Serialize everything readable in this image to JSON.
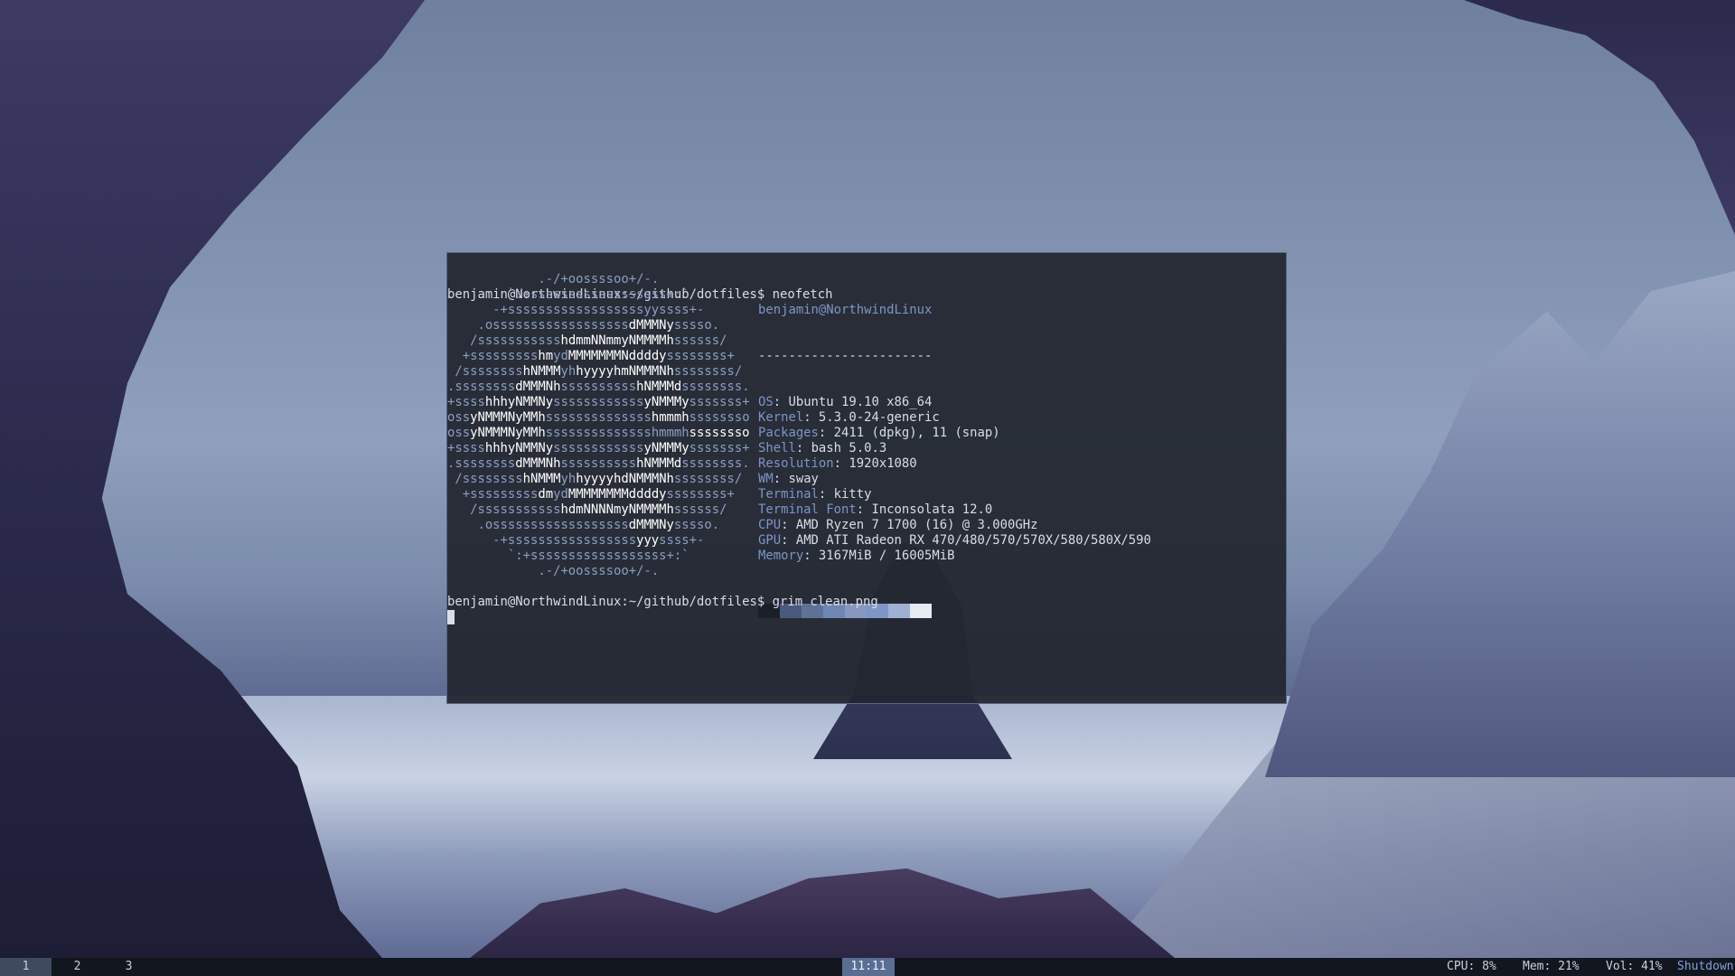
{
  "terminal": {
    "prompt1": "benjamin@NorthwindLinux:~/github/dotfiles$ neofetch",
    "logo": [
      [
        "            .-/+oossssoo+/-.",
        ""
      ],
      [
        "        `:+ssssssssssssssssss+:`",
        ""
      ],
      [
        "      -+ssssssssssssssssssyyssss+-",
        ""
      ],
      [
        "    .ossssssssssssssssss",
        "dMMMNy",
        "sssso."
      ],
      [
        "   /sssssssssss",
        "hdmmNNmmyNMMMMh",
        "ssssss/"
      ],
      [
        "  +sssssssss",
        "hm",
        "yd",
        "MMMMMMMNddddy",
        "ssssssss+"
      ],
      [
        " /ssssssss",
        "hNMMM",
        "yh",
        "hyyyyhmNMMMNh",
        "ssssssss/"
      ],
      [
        ".ssssssss",
        "dMMMNh",
        "ssssssssss",
        "hNMMMd",
        "ssssssss."
      ],
      [
        "+ssss",
        "hhhyNMMNy",
        "ssssssssssss",
        "yNMMMy",
        "sssssss+"
      ],
      [
        "oss",
        "yNMMMNyMMh",
        "ssssssssssssss",
        "hmmmh",
        "ssssssso"
      ],
      [
        "oss",
        "yNMMMNyMMh",
        "sssssssssssssshmmmh",
        "ssssssso",
        ""
      ],
      [
        "+ssss",
        "hhhyNMMNy",
        "ssssssssssss",
        "yNMMMy",
        "sssssss+"
      ],
      [
        ".ssssssss",
        "dMMMNh",
        "ssssssssss",
        "hNMMMd",
        "ssssssss."
      ],
      [
        " /ssssssss",
        "hNMMM",
        "yh",
        "hyyyyhdNMMMNh",
        "ssssssss/"
      ],
      [
        "  +sssssssss",
        "dm",
        "yd",
        "MMMMMMMMddddy",
        "ssssssss+"
      ],
      [
        "   /sssssssssss",
        "hdmNNNNmyNMMMMh",
        "ssssss/"
      ],
      [
        "    .ossssssssssssssssss",
        "dMMMNy",
        "sssso."
      ],
      [
        "      -+sssssssssssssssss",
        "yyy",
        "ssss+-"
      ],
      [
        "        `:+ssssssssssssssssss+:`",
        ""
      ],
      [
        "            .-/+oossssoo+/-.",
        ""
      ]
    ],
    "user_host": "benjamin@NorthwindLinux",
    "separator": "-----------------------",
    "info": [
      {
        "key": "OS",
        "value": "Ubuntu 19.10 x86_64"
      },
      {
        "key": "Kernel",
        "value": "5.3.0-24-generic"
      },
      {
        "key": "Packages",
        "value": "2411 (dpkg), 11 (snap)"
      },
      {
        "key": "Shell",
        "value": "bash 5.0.3"
      },
      {
        "key": "Resolution",
        "value": "1920x1080"
      },
      {
        "key": "WM",
        "value": "sway"
      },
      {
        "key": "Terminal",
        "value": "kitty"
      },
      {
        "key": "Terminal Font",
        "value": "Inconsolata 12.0"
      },
      {
        "key": "CPU",
        "value": "AMD Ryzen 7 1700 (16) @ 3.000GHz"
      },
      {
        "key": "GPU",
        "value": "AMD ATI Radeon RX 470/480/570/570X/580/580X/590"
      },
      {
        "key": "Memory",
        "value": "3167MiB / 16005MiB"
      }
    ],
    "palette": [
      "#1b1f27",
      "#4a5a7c",
      "#5f7296",
      "#6f86b2",
      "#8797bd",
      "#7f95c6",
      "#9fb0d3",
      "#e6ebf2"
    ],
    "prompt2": "benjamin@NorthwindLinux:~/github/dotfiles$ grim clean.png"
  },
  "bar": {
    "workspaces": [
      "1",
      "2",
      "3"
    ],
    "clock": "11:11",
    "cpu": "CPU: 8%",
    "mem": "Mem: 21%",
    "vol": "Vol: 41%",
    "shutdown": "Shutdown"
  }
}
